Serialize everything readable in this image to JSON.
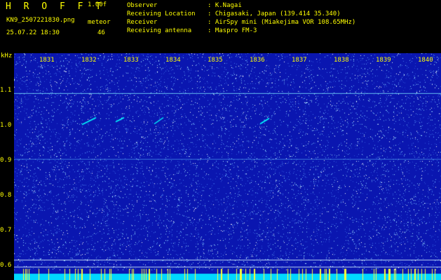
{
  "header": {
    "app_title": "H R O F F T",
    "version": "1.00f",
    "filename": "KN9_2507221830.png",
    "meteor_label": "meteor",
    "datetime": "25.07.22 18:30",
    "meteor_count": "46"
  },
  "info": [
    {
      "key": "Observer",
      "value": ": K.Nagai"
    },
    {
      "key": "Receiving Location",
      "value": ": Chigasaki, Japan (139.414 35.340)"
    },
    {
      "key": "Receiver",
      "value": ": AirSpy mini (Miakejima VOR 108.65MHz)"
    },
    {
      "key": "Receiving antenna",
      "value": ": Maspro FM-3"
    }
  ],
  "plot": {
    "y_unit": "kHz",
    "x_ticks": [
      "1831",
      "1832",
      "1833",
      "1834",
      "1835",
      "1836",
      "1837",
      "1838",
      "1839",
      "1840"
    ],
    "y_ticks": [
      "1.1",
      "1.0",
      "0.9",
      "0.8",
      "0.7",
      "0.6"
    ],
    "colors": {
      "background": "#0a16b0",
      "noise": "#7fd6ff",
      "signal": "#00ffff",
      "label": "#ffff00"
    }
  }
}
